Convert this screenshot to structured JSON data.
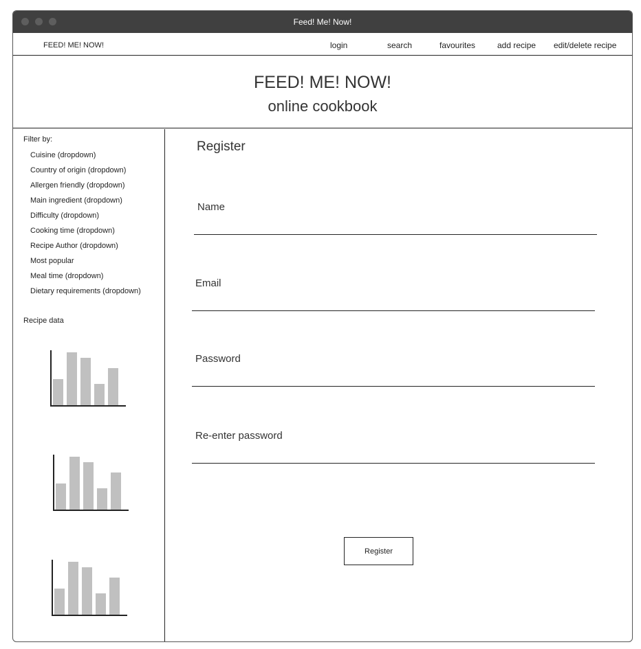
{
  "window": {
    "title": "Feed! Me! Now!"
  },
  "navbar": {
    "brand": "FEED! ME! NOW!",
    "links": [
      {
        "label": "login"
      },
      {
        "label": "search"
      },
      {
        "label": "favourites"
      },
      {
        "label": "add recipe"
      },
      {
        "label": "edit/delete recipe"
      }
    ]
  },
  "header": {
    "title": "FEED! ME! NOW!",
    "subtitle": "online cookbook"
  },
  "sidebar": {
    "filter_heading": "Filter by:",
    "filters": [
      "Cuisine (dropdown)",
      "Country of origin (dropdown)",
      "Allergen friendly (dropdown)",
      "Main ingredient (dropdown)",
      "Difficulty (dropdown)",
      "Cooking time  (dropdown)",
      "Recipe Author (dropdown)",
      "Most popular",
      "Meal time (dropdown)",
      "Dietary requirements (dropdown)"
    ],
    "recipe_data_heading": "Recipe data"
  },
  "chart_data": [
    {
      "type": "bar",
      "values": [
        38,
        77,
        69,
        31,
        54
      ]
    },
    {
      "type": "bar",
      "values": [
        38,
        77,
        69,
        31,
        54
      ]
    },
    {
      "type": "bar",
      "values": [
        38,
        77,
        69,
        31,
        54
      ]
    }
  ],
  "form": {
    "title": "Register",
    "fields": [
      {
        "label": "Name",
        "value": ""
      },
      {
        "label": "Email",
        "value": ""
      },
      {
        "label": "Password",
        "value": ""
      },
      {
        "label": "Re-enter password",
        "value": ""
      }
    ],
    "submit_label": "Register"
  }
}
